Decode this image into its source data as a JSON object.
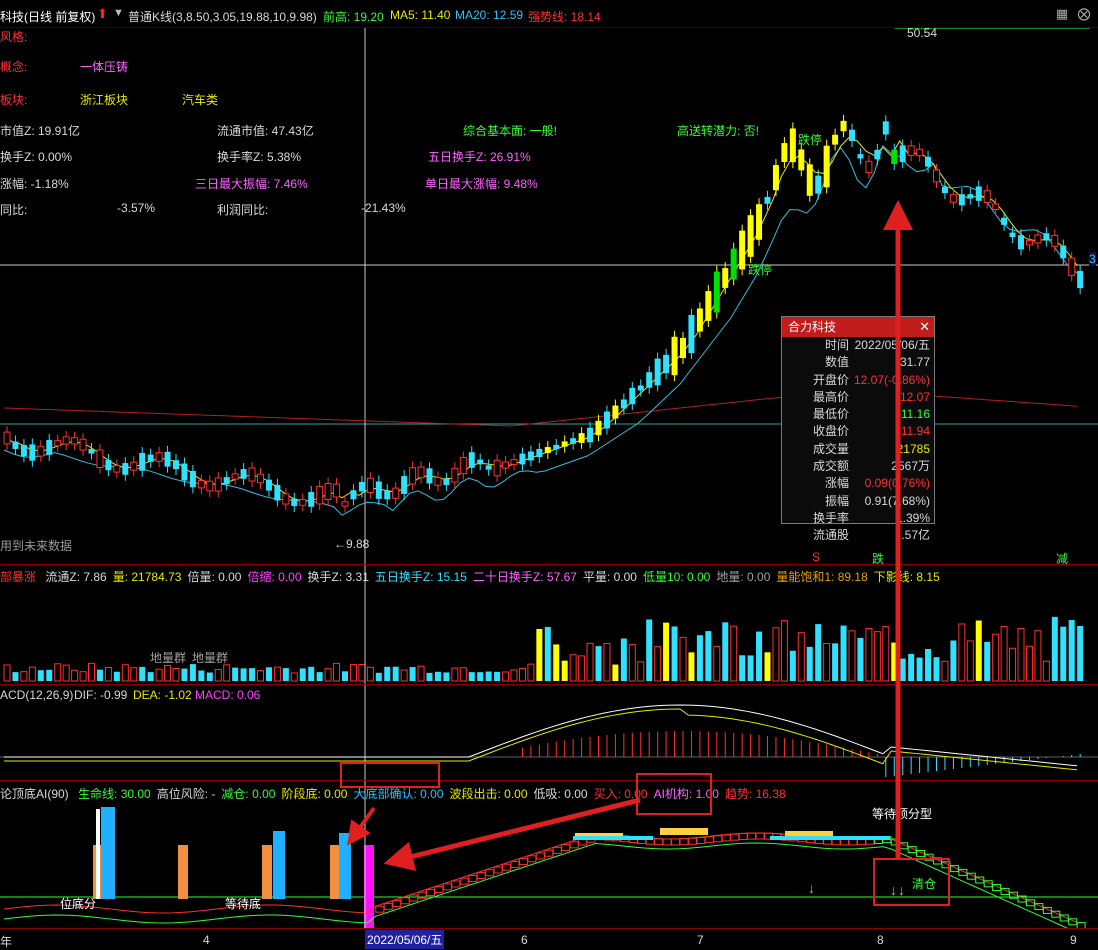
{
  "header": {
    "title": "科技(日线 前复权)",
    "chart_type_label": "普通K线(3,8.50,3.05,19.88,10,9.98)",
    "prev_high_label": "前高: 19.20",
    "ma5_label": "MA5: 11.40",
    "ma20_label": "MA20: 12.59",
    "strong_label": "强势线: 18.14"
  },
  "info": {
    "style_label": "风格:",
    "concept_label": "概念:",
    "concept_value": "一体压铸",
    "sector_label": "板块:",
    "sector_value1": "浙江板块",
    "sector_value2": "汽车类",
    "mktcap": "市值Z: 19.91亿",
    "float_mktcap": "流通市值: 47.43亿",
    "fundamental": "综合基本面: 一般!",
    "potential": "高送转潜力: 否!",
    "turnover_z": "换手Z: 0.00%",
    "turnover_rate_z": "换手率Z: 5.38%",
    "five_day_turnover": "五日换手Z: 26.91%",
    "amplitude": "涨幅: -1.18%",
    "three_day_amp": "三日最大振幅: 7.46%",
    "single_day_max": "单日最大涨幅: 9.48%",
    "yoy_label": "同比:",
    "yoy_value": "-3.57%",
    "profit_yoy_label": "利润同比:",
    "profit_yoy_value": "-21.43%"
  },
  "price_marks": {
    "high_mark": "50.54",
    "low_mark": "←9.88",
    "future_data": "用到未来数据",
    "die1": "跌停",
    "die2": "跌停",
    "right_price": "3",
    "bottom_s": "S",
    "bottom_die": "跌",
    "bottom_jian": "减"
  },
  "tooltip": {
    "title": "合力科技",
    "rows": [
      {
        "k": "时间",
        "v": "2022/05/06/五",
        "color": "#d8d8d8"
      },
      {
        "k": "数值",
        "v": "31.77",
        "color": "#d8d8d8"
      },
      {
        "k": "开盘价",
        "v": "12.07(-0.86%)",
        "color": "#ff3030"
      },
      {
        "k": "最高价",
        "v": "12.07",
        "color": "#ff3030"
      },
      {
        "k": "最低价",
        "v": "11.16",
        "color": "#30ff30"
      },
      {
        "k": "收盘价",
        "v": "11.94",
        "color": "#ff3030"
      },
      {
        "k": "成交量",
        "v": "21785",
        "color": "#e8e800"
      },
      {
        "k": "成交额",
        "v": "2567万",
        "color": "#d8d8d8"
      },
      {
        "k": "涨幅",
        "v": "0.09(0.76%)",
        "color": "#ff3030"
      },
      {
        "k": "振幅",
        "v": "0.91(7.68%)",
        "color": "#d8d8d8"
      },
      {
        "k": "换手率",
        "v": "1.39%",
        "color": "#d8d8d8"
      },
      {
        "k": "流通股",
        "v": "1.57亿",
        "color": "#d8d8d8"
      }
    ]
  },
  "volume": {
    "title": "部暴涨",
    "items": [
      {
        "label": "流通Z: 7.86",
        "color": "#d8d8d8"
      },
      {
        "label": "量: 21784.73",
        "color": "#e8e800"
      },
      {
        "label": "倍量: 0.00",
        "color": "#d8d8d8"
      },
      {
        "label": "倍缩: 0.00",
        "color": "#ff40ff"
      },
      {
        "label": "换手Z: 3.31",
        "color": "#d8d8d8"
      },
      {
        "label": "五日换手Z: 15.15",
        "color": "#30e0ff"
      },
      {
        "label": "二十日换手Z: 57.67",
        "color": "#ff60ff"
      },
      {
        "label": "平量: 0.00",
        "color": "#d8d8d8"
      },
      {
        "label": "低量10: 0.00",
        "color": "#30ff30"
      },
      {
        "label": "地量: 0.00",
        "color": "#a0a0a0"
      },
      {
        "label": "量能饱和1: 89.18",
        "color": "#e8a000"
      },
      {
        "label": "下影线: 8.15",
        "color": "#e8e800"
      }
    ],
    "ground1": "地量群",
    "ground2": "地量群"
  },
  "macd": {
    "title": "ACD(12,26,9)",
    "dif": "DIF: -0.99",
    "dea": "DEA: -1.02",
    "macd": "MACD: 0.06"
  },
  "ai": {
    "title": "论顶底AI(90)",
    "items": [
      {
        "label": "生命线: 30.00",
        "color": "#30ff30"
      },
      {
        "label": "高位风险: -",
        "color": "#d8d8d8"
      },
      {
        "label": "减仓: 0.00",
        "color": "#30ff30"
      },
      {
        "label": "阶段底: 0.00",
        "color": "#e8e800"
      },
      {
        "label": "大底部确认: 0.00",
        "color": "#30c0ff"
      },
      {
        "label": "波段出击: 0.00",
        "color": "#e8e800"
      },
      {
        "label": "低吸: 0.00",
        "color": "#d8d8d8"
      },
      {
        "label": "买入: 0.00",
        "color": "#ff3030"
      },
      {
        "label": "AI机构: 1.00",
        "color": "#ff60ff"
      },
      {
        "label": "趋势: 16.38",
        "color": "#ff3030"
      }
    ],
    "wait_top": "等待顶分型",
    "clear": "清仓",
    "wait_bottom": "等待底",
    "pos_dist": "位底分"
  },
  "axis": {
    "date_label": "2022/05/06/五",
    "tick_year": "年",
    "tick_4": "4",
    "tick_6": "6",
    "tick_7": "7",
    "tick_8": "8",
    "tick_9": "9"
  },
  "colors": {
    "up": "#ff3030",
    "down": "#30e0ff",
    "yellow": "#ffff00",
    "green": "#00e000",
    "accent_red": "#e02020"
  }
}
